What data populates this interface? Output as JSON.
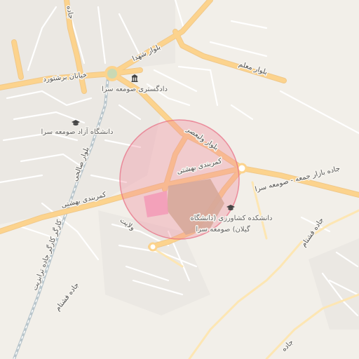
{
  "map": {
    "colors": {
      "background": "#f2efe9",
      "major_road": "#fcd38d",
      "minor_road": "#ffffff",
      "railway": "#b0c4d0",
      "highlight_circle": "#f08a9b",
      "campus": "#c9b99a",
      "pink_area": "#f4a6c8"
    },
    "highlight": {
      "shape": "circle",
      "color": "#f08a9b"
    },
    "road_labels": [
      {
        "id": "blvd-shohada",
        "text": "بلوار شهدا"
      },
      {
        "id": "khiaban-borshtorud",
        "text": "خیابان برشتورد"
      },
      {
        "id": "blvd-moalem",
        "text": "بلوار معلم"
      },
      {
        "id": "blvd-valiasr",
        "text": "بلوار ولیعصر"
      },
      {
        "id": "kamarbandi-1",
        "text": "کمربندی بهشتی"
      },
      {
        "id": "kamarbandi-2",
        "text": "کمربندی بهشتی"
      },
      {
        "id": "jadeh-bazar",
        "text": "جاده بازار جمعه - صومعه سرا"
      },
      {
        "id": "blvd-salehi",
        "text": "بلوار صالحی"
      },
      {
        "id": "vilayat",
        "text": "ولایت"
      },
      {
        "id": "kargar",
        "text": "کارگر کارگر جاده ترابزیت"
      },
      {
        "id": "jadeh-fashtam-1",
        "text": "جاده فشتام"
      },
      {
        "id": "jadeh-fashtam-2",
        "text": "جاده فشتام"
      },
      {
        "id": "jadeh-top-left",
        "text": "جاده"
      },
      {
        "id": "jadeh-bottom-right",
        "text": "جاده"
      }
    ],
    "pois": [
      {
        "id": "court",
        "icon": "courthouse-icon",
        "text": "دادگستری صومعه سرا"
      },
      {
        "id": "azad-univ",
        "icon": "graduation-cap-icon",
        "text": "دانشگاه آزاد صومعه سرا"
      },
      {
        "id": "agri-college",
        "icon": "graduation-cap-icon",
        "line1": "دانشکده کشاورزی (دانشگاه",
        "line2": "گیلان) صومعه سرا"
      }
    ]
  }
}
